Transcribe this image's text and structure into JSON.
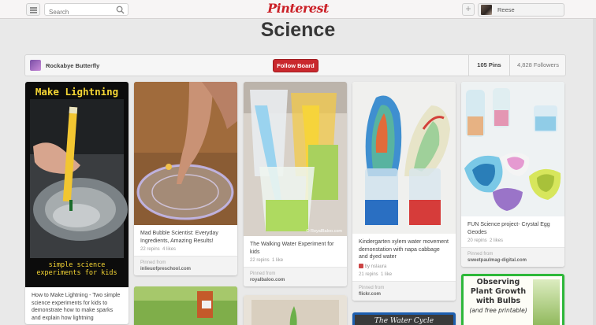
{
  "header": {
    "search_placeholder": "Search",
    "logo": "Pinterest",
    "add_label": "+",
    "user_name": "Reese"
  },
  "board": {
    "title": "Science",
    "owner": "Rockabye Butterfly",
    "follow_label": "Follow Board",
    "pins_count": "105 Pins",
    "followers_count": "4,828 Followers"
  },
  "pins": [
    {
      "image_text_top": "Make Lightning",
      "image_text_bottom": "simple science experiments for kids",
      "description": "How to Make Lightning - Two simple science experiments for kids to demonstrate how to make sparks and explain how lightning"
    },
    {
      "description": "Mad Bubble Scientist: Everyday Ingredients, Amazing Results!",
      "repins": "22 repins",
      "likes": "4 likes",
      "source_label": "Pinned from",
      "source": "inlieuofpreschool.com"
    },
    {
      "watermark": "© RoyalBaloo.com",
      "description": "The Walking Water Experiment for kids",
      "repins": "22 repins",
      "likes": "1 like",
      "source_label": "Pinned from",
      "source": "royalbaloo.com"
    },
    {
      "description": "Kindergarten xylem water movement demonstation with napa cabbage and dyed water",
      "user": "by nslaura",
      "repins": "21 repins",
      "likes": "1 like",
      "source_label": "Pinned from",
      "source": "flickr.com"
    },
    {
      "description": "FUN Science project- Crystal Egg Geodes",
      "repins": "20 repins",
      "likes": "2 likes",
      "source_label": "Pinned from",
      "source": "sweetpaulmag-digital.com"
    }
  ],
  "lower_pins": {
    "water_cycle_text": "The Water Cycle",
    "bulbs_text_1": "Observing",
    "bulbs_text_2": "Plant Growth",
    "bulbs_text_3": "with Bulbs",
    "bulbs_text_4": "(and free printable)"
  }
}
